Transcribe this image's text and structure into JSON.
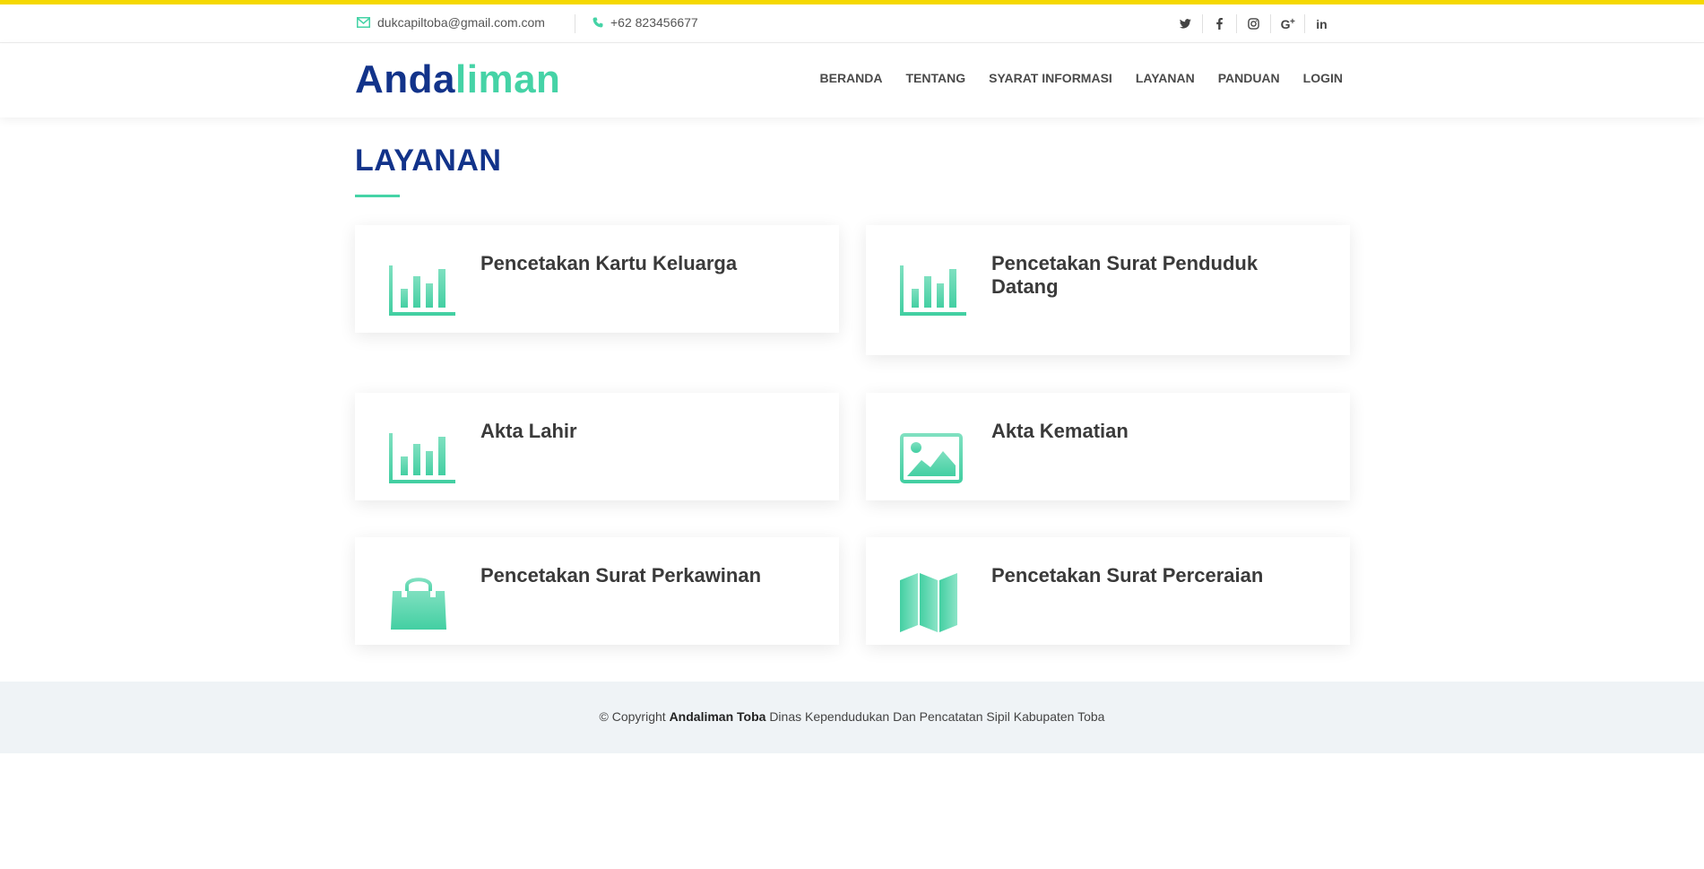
{
  "topbar": {
    "email": "dukcapiltoba@gmail.com.com",
    "phone": "+62 823456677",
    "social": [
      {
        "name": "twitter-icon",
        "glyph": "t"
      },
      {
        "name": "facebook-icon",
        "glyph": "f"
      },
      {
        "name": "instagram-icon",
        "glyph": "◎"
      },
      {
        "name": "google-plus-icon",
        "glyph": "G+"
      },
      {
        "name": "linkedin-icon",
        "glyph": "in"
      }
    ]
  },
  "header": {
    "logo_part1": "Anda",
    "logo_part2": "liman",
    "nav": [
      "BERANDA",
      "TENTANG",
      "SYARAT INFORMASI",
      "LAYANAN",
      "PANDUAN",
      "LOGIN"
    ]
  },
  "main": {
    "title": "LAYANAN",
    "services": [
      {
        "title": "Pencetakan Kartu Keluarga",
        "icon": "bar-chart-icon"
      },
      {
        "title": "Pencetakan Surat Penduduk Datang",
        "icon": "bar-chart-icon"
      },
      {
        "title": "Akta Lahir",
        "icon": "bar-chart-icon"
      },
      {
        "title": "Akta Kematian",
        "icon": "image-icon"
      },
      {
        "title": "Pencetakan Surat Perkawinan",
        "icon": "shopping-bag-icon"
      },
      {
        "title": "Pencetakan Surat Perceraian",
        "icon": "map-icon"
      }
    ]
  },
  "footer": {
    "prefix": "© Copyright",
    "brand": "Andaliman Toba",
    "suffix": "Dinas Kependudukan Dan Pencatatan Sipil Kabupaten Toba"
  },
  "colors": {
    "accent_yellow": "#f5d800",
    "brand_blue": "#12338a",
    "brand_green": "#45d3a6",
    "footer_bg": "#eff3f6"
  }
}
